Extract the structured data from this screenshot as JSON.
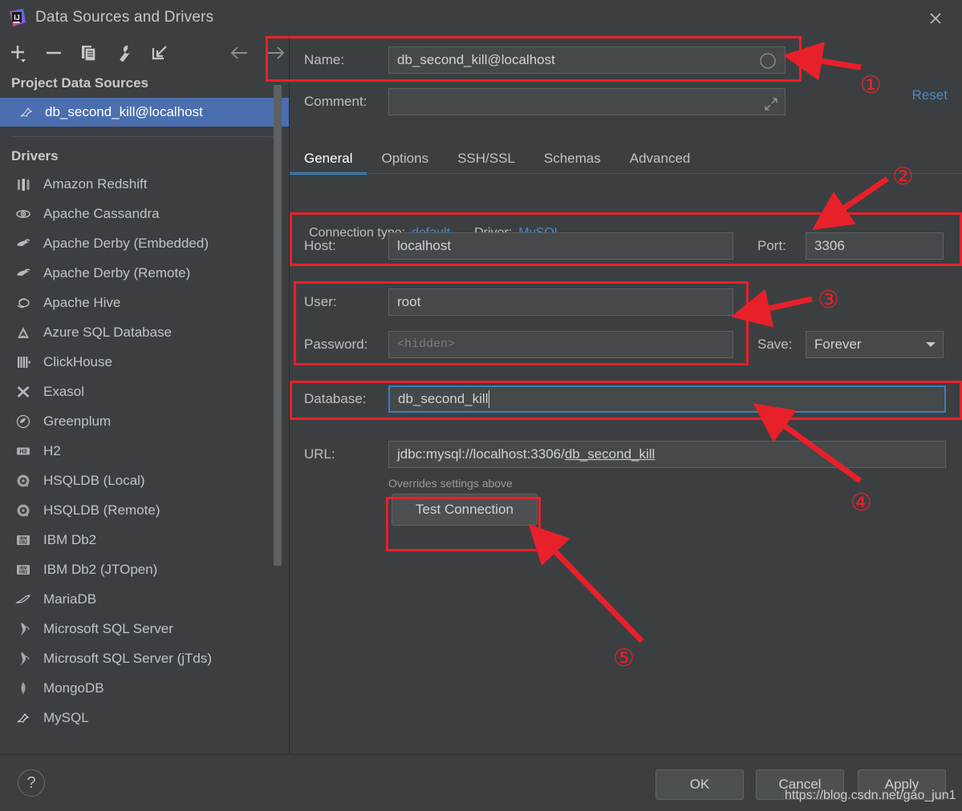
{
  "window": {
    "title": "Data Sources and Drivers",
    "logo_icon": "intellij-idea-logo",
    "close_icon": "close-icon"
  },
  "toolbar": {
    "items": [
      {
        "name": "add-button",
        "icon": "plus-icon"
      },
      {
        "name": "remove-button",
        "icon": "minus-icon"
      },
      {
        "name": "duplicate-button",
        "icon": "copy-icon"
      },
      {
        "name": "properties-button",
        "icon": "wrench-icon"
      },
      {
        "name": "import-button",
        "icon": "import-arrow-icon"
      }
    ],
    "nav_back_icon": "arrow-left-icon",
    "nav_forward_icon": "arrow-right-icon"
  },
  "sidebar": {
    "project_section_title": "Project Data Sources",
    "data_sources": [
      {
        "label": "db_second_kill@localhost",
        "icon": "mysql-icon",
        "selected": true
      }
    ],
    "drivers_section_title": "Drivers",
    "drivers": [
      {
        "label": "Amazon Redshift",
        "icon": "redshift-icon"
      },
      {
        "label": "Apache Cassandra",
        "icon": "cassandra-icon"
      },
      {
        "label": "Apache Derby (Embedded)",
        "icon": "derby-icon"
      },
      {
        "label": "Apache Derby (Remote)",
        "icon": "derby-icon"
      },
      {
        "label": "Apache Hive",
        "icon": "hive-icon"
      },
      {
        "label": "Azure SQL Database",
        "icon": "azure-icon"
      },
      {
        "label": "ClickHouse",
        "icon": "clickhouse-icon"
      },
      {
        "label": "Exasol",
        "icon": "exasol-icon"
      },
      {
        "label": "Greenplum",
        "icon": "greenplum-icon"
      },
      {
        "label": "H2",
        "icon": "h2-icon"
      },
      {
        "label": "HSQLDB (Local)",
        "icon": "hsqldb-icon"
      },
      {
        "label": "HSQLDB (Remote)",
        "icon": "hsqldb-icon"
      },
      {
        "label": "IBM Db2",
        "icon": "db2-icon"
      },
      {
        "label": "IBM Db2 (JTOpen)",
        "icon": "db2-icon"
      },
      {
        "label": "MariaDB",
        "icon": "mariadb-icon"
      },
      {
        "label": "Microsoft SQL Server",
        "icon": "mssql-icon"
      },
      {
        "label": "Microsoft SQL Server (jTds)",
        "icon": "mssql-icon"
      },
      {
        "label": "MongoDB",
        "icon": "mongodb-icon"
      },
      {
        "label": "MySQL",
        "icon": "mysql-icon"
      }
    ]
  },
  "form": {
    "name_label": "Name:",
    "name_value": "db_second_kill@localhost",
    "name_indicator_icon": "circle-icon",
    "comment_label": "Comment:",
    "comment_value": "",
    "comment_expand_icon": "expand-diagonal-icon",
    "reset_label": "Reset",
    "tabs": [
      {
        "label": "General",
        "active": true
      },
      {
        "label": "Options",
        "active": false
      },
      {
        "label": "SSH/SSL",
        "active": false
      },
      {
        "label": "Schemas",
        "active": false
      },
      {
        "label": "Advanced",
        "active": false
      }
    ],
    "connection_type_label": "Connection type:",
    "connection_type_value": "default",
    "driver_label": "Driver:",
    "driver_value": "MySQL",
    "host_label": "Host:",
    "host_value": "localhost",
    "port_label": "Port:",
    "port_value": "3306",
    "user_label": "User:",
    "user_value": "root",
    "password_label": "Password:",
    "password_placeholder": "<hidden>",
    "save_label": "Save:",
    "save_value": "Forever",
    "save_dropdown_icon": "chevron-down-icon",
    "database_label": "Database:",
    "database_value": "db_second_kill",
    "url_label": "URL:",
    "url_value_prefix": "jdbc:mysql://localhost:3306/",
    "url_value_suffix": "db_second_kill",
    "url_hint": "Overrides settings above",
    "test_connection_label": "Test Connection"
  },
  "footer": {
    "help_icon": "question-mark-icon",
    "ok_label": "OK",
    "cancel_label": "Cancel",
    "apply_label": "Apply",
    "watermark": "https://blog.csdn.net/gao_jun1"
  },
  "annotations": {
    "accent_color": "#e8202a",
    "markers": [
      {
        "number": "①"
      },
      {
        "number": "②"
      },
      {
        "number": "③"
      },
      {
        "number": "④"
      },
      {
        "number": "⑤"
      }
    ]
  },
  "colors": {
    "background": "#3c3f41",
    "selection": "#4b6eaf",
    "link": "#4a88c7",
    "annotation": "#e8202a"
  }
}
